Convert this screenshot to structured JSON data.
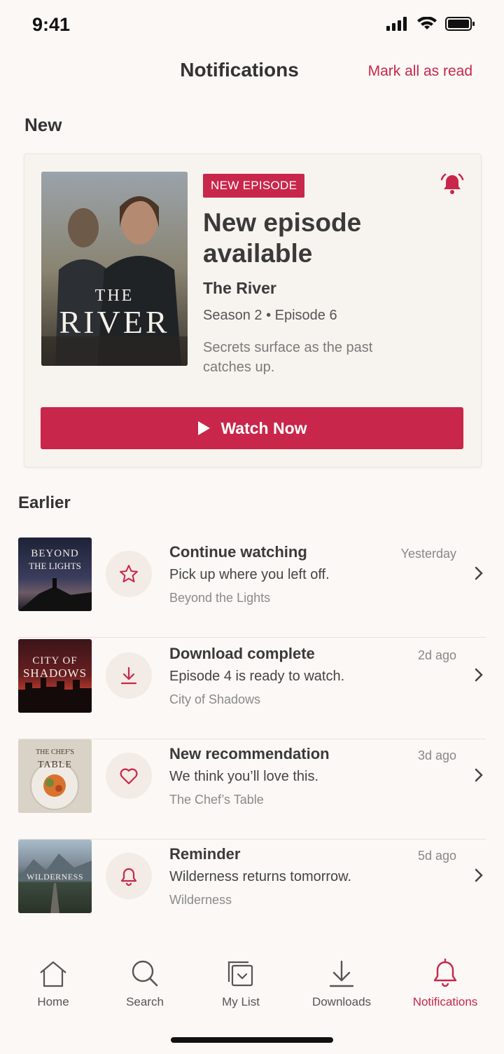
{
  "status": {
    "time": "9:41"
  },
  "header": {
    "title": "Notifications",
    "mark_all": "Mark all as read"
  },
  "sections": {
    "new": "New",
    "earlier": "Earlier"
  },
  "featured": {
    "badge": "NEW EPISODE",
    "heading": "New episode available",
    "show": "The River",
    "meta": "Season 2 • Episode 6",
    "description": "Secrets surface as the past catches up.",
    "button": "Watch Now",
    "poster": {
      "line1": "THE",
      "line2": "RIVER"
    }
  },
  "earlier": [
    {
      "title": "Continue watching",
      "message": "Pick up where you left off.",
      "show": "Beyond the Lights",
      "time": "Yesterday",
      "icon": "star-icon",
      "poster": {
        "line1": "BEYOND",
        "line2": "THE LIGHTS"
      }
    },
    {
      "title": "Download complete",
      "message": "Episode 4 is ready to watch.",
      "show": "City of Shadows",
      "time": "2d ago",
      "icon": "download-icon",
      "poster": {
        "line1": "CITY OF",
        "line2": "SHADOWS"
      }
    },
    {
      "title": "New recommendation",
      "message": "We think you’ll love this.",
      "show": "The Chef’s Table",
      "time": "3d ago",
      "icon": "heart-icon",
      "poster": {
        "line1": "THE CHEF'S",
        "line2": "TABLE"
      }
    },
    {
      "title": "Reminder",
      "message": "Wilderness returns tomorrow.",
      "show": "Wilderness",
      "time": "5d ago",
      "icon": "bell-icon",
      "poster": {
        "line1": "",
        "line2": "WILDERNESS"
      }
    }
  ],
  "nav": {
    "home": "Home",
    "search": "Search",
    "mylist": "My List",
    "downloads": "Downloads",
    "notifications": "Notifications"
  },
  "colors": {
    "accent": "#c8264a",
    "background": "#fbf8f5"
  }
}
